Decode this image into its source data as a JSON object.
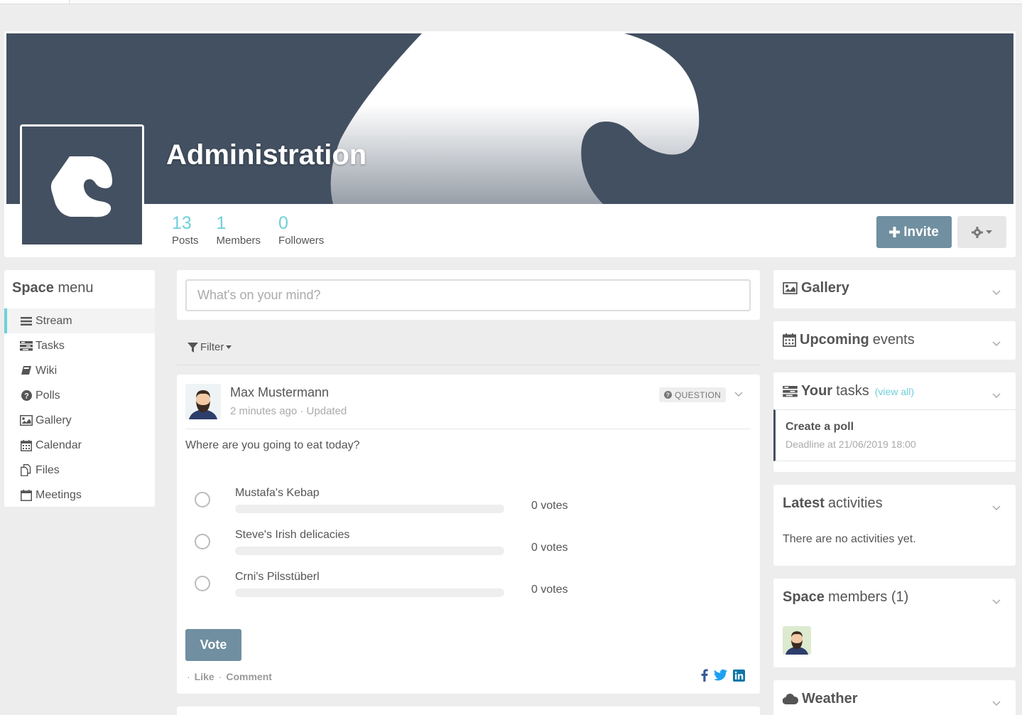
{
  "space": {
    "name": "Administration",
    "stats": [
      {
        "value": "13",
        "label": "Posts"
      },
      {
        "value": "1",
        "label": "Members"
      },
      {
        "value": "0",
        "label": "Followers"
      }
    ],
    "invite_label": "Invite",
    "colors": {
      "banner": "#435061",
      "accent": "#6fd0da",
      "button": "#708fa0"
    }
  },
  "space_menu": {
    "title_bold": "Space",
    "title_rest": "menu",
    "items": [
      {
        "label": "Stream",
        "icon": "bars-icon",
        "active": true
      },
      {
        "label": "Tasks",
        "icon": "tasks-icon"
      },
      {
        "label": "Wiki",
        "icon": "book-icon"
      },
      {
        "label": "Polls",
        "icon": "question-circle-icon"
      },
      {
        "label": "Gallery",
        "icon": "image-icon"
      },
      {
        "label": "Calendar",
        "icon": "calendar-icon"
      },
      {
        "label": "Files",
        "icon": "files-icon"
      },
      {
        "label": "Meetings",
        "icon": "calendar-blank-icon"
      }
    ]
  },
  "composer": {
    "placeholder": "What's on your mind?"
  },
  "filter": {
    "label": "Filter"
  },
  "post": {
    "author": "Max Mustermann",
    "meta": "2 minutes ago · Updated",
    "badge": "QUESTION",
    "question": "Where are you going to eat today?",
    "options": [
      {
        "label": "Mustafa's Kebap",
        "votes": "0 votes",
        "fraction": 0
      },
      {
        "label": "Steve's Irish delicacies",
        "votes": "0 votes",
        "fraction": 0
      },
      {
        "label": "Crni's Pilsstüberl",
        "votes": "0 votes",
        "fraction": 0
      }
    ],
    "vote_label": "Vote",
    "like_label": "Like",
    "comment_label": "Comment"
  },
  "widgets": {
    "gallery": {
      "title_bold": "Gallery"
    },
    "events": {
      "title_bold": "Upcoming",
      "title_rest": "events"
    },
    "tasks": {
      "title_bold": "Your",
      "title_rest": "tasks",
      "view_all": "(view all)",
      "items": [
        {
          "title": "Create a poll",
          "deadline": "Deadline at 21/06/2019 18:00"
        }
      ]
    },
    "activities": {
      "title_bold": "Latest",
      "title_rest": "activities",
      "empty": "There are no activities yet."
    },
    "members": {
      "title_bold": "Space",
      "title_rest": "members (1)"
    },
    "weather": {
      "title_bold": "Weather"
    }
  }
}
